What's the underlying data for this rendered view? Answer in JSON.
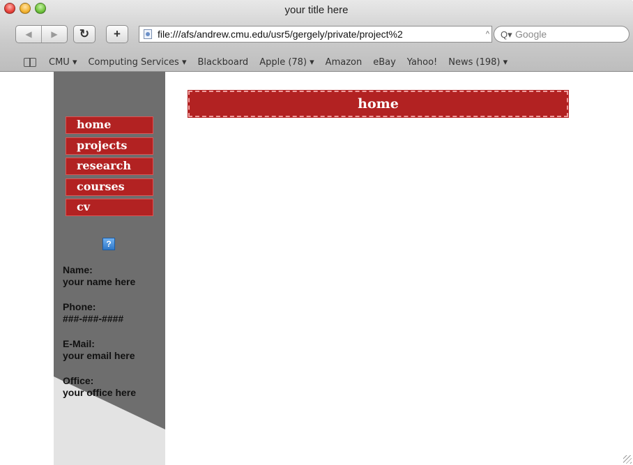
{
  "window": {
    "title": "your title here"
  },
  "toolbar": {
    "url": "file:///afs/andrew.cmu.edu/usr5/gergely/private/project%2",
    "search_placeholder": "Google"
  },
  "bookmarks": [
    "CMU ▾",
    "Computing Services ▾",
    "Blackboard",
    "Apple (78) ▾",
    "Amazon",
    "eBay",
    "Yahoo!",
    "News (198) ▾"
  ],
  "sidebar": {
    "nav": [
      "home",
      "projects",
      "research",
      "courses",
      "cv"
    ],
    "contact": [
      {
        "label": "Name:",
        "value": "your name here"
      },
      {
        "label": "Phone:",
        "value": "###-###-####"
      },
      {
        "label": "E-Mail:",
        "value": "your email here"
      },
      {
        "label": "Office:",
        "value": "your office here"
      }
    ]
  },
  "main": {
    "header": "home"
  },
  "colors": {
    "accent": "#b22222",
    "sidebar_dark": "#6e6e6e",
    "sidebar_light": "#e3e3e3"
  }
}
